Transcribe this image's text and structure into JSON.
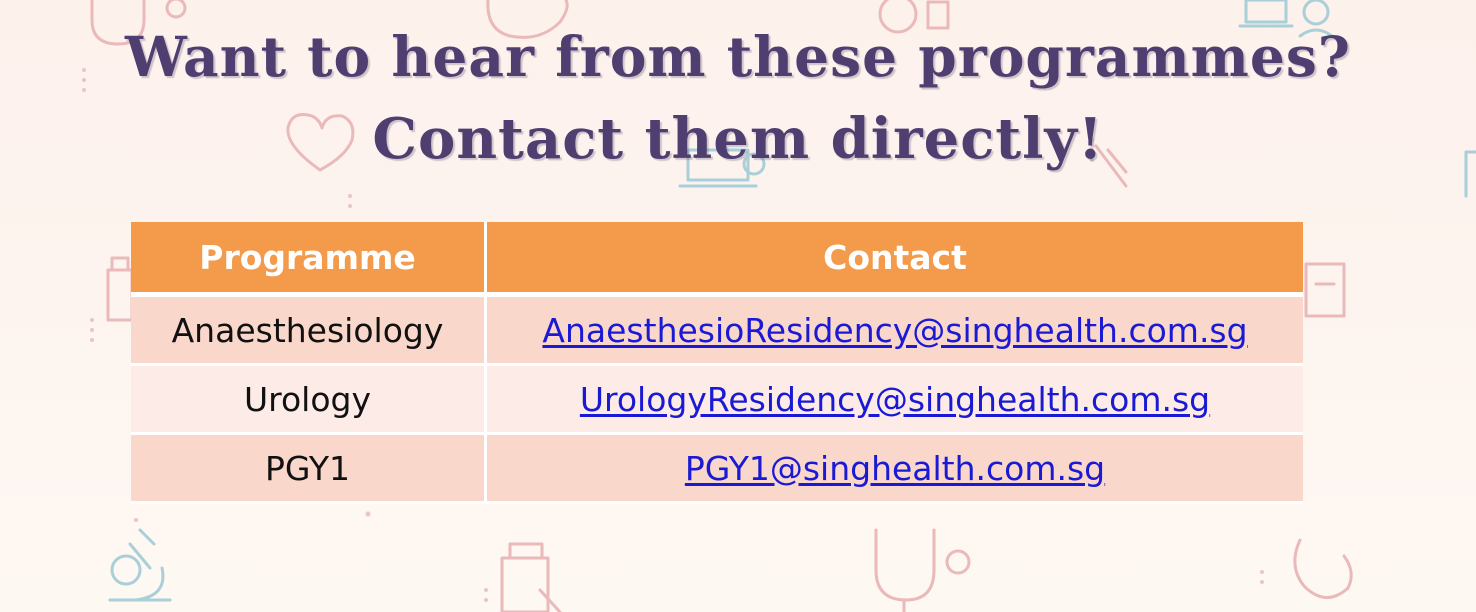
{
  "title": {
    "line1": "Want to hear from these programmes?",
    "line2": "Contact them directly!"
  },
  "table": {
    "headers": {
      "programme": "Programme",
      "contact": "Contact"
    },
    "rows": [
      {
        "programme": "Anaesthesiology",
        "contact": "AnaesthesioResidency@singhealth.com.sg"
      },
      {
        "programme": "Urology",
        "contact": "UrologyResidency@singhealth.com.sg"
      },
      {
        "programme": "PGY1",
        "contact": "PGY1@singhealth.com.sg"
      }
    ]
  },
  "colors": {
    "title": "#4f3f70",
    "header_bg": "#f39a4b",
    "row_odd_bg": "#fad7cb",
    "row_even_bg": "#fcebe7",
    "link": "#1a1ad4"
  },
  "background_icons": [
    "stethoscope-icon",
    "stomach-icon",
    "doctor-icon",
    "heart-icon",
    "laptop-icon",
    "syringe-icon",
    "pill-bottle-icon",
    "clipboard-icon",
    "microscope-icon",
    "medicine-bottle-icon"
  ]
}
